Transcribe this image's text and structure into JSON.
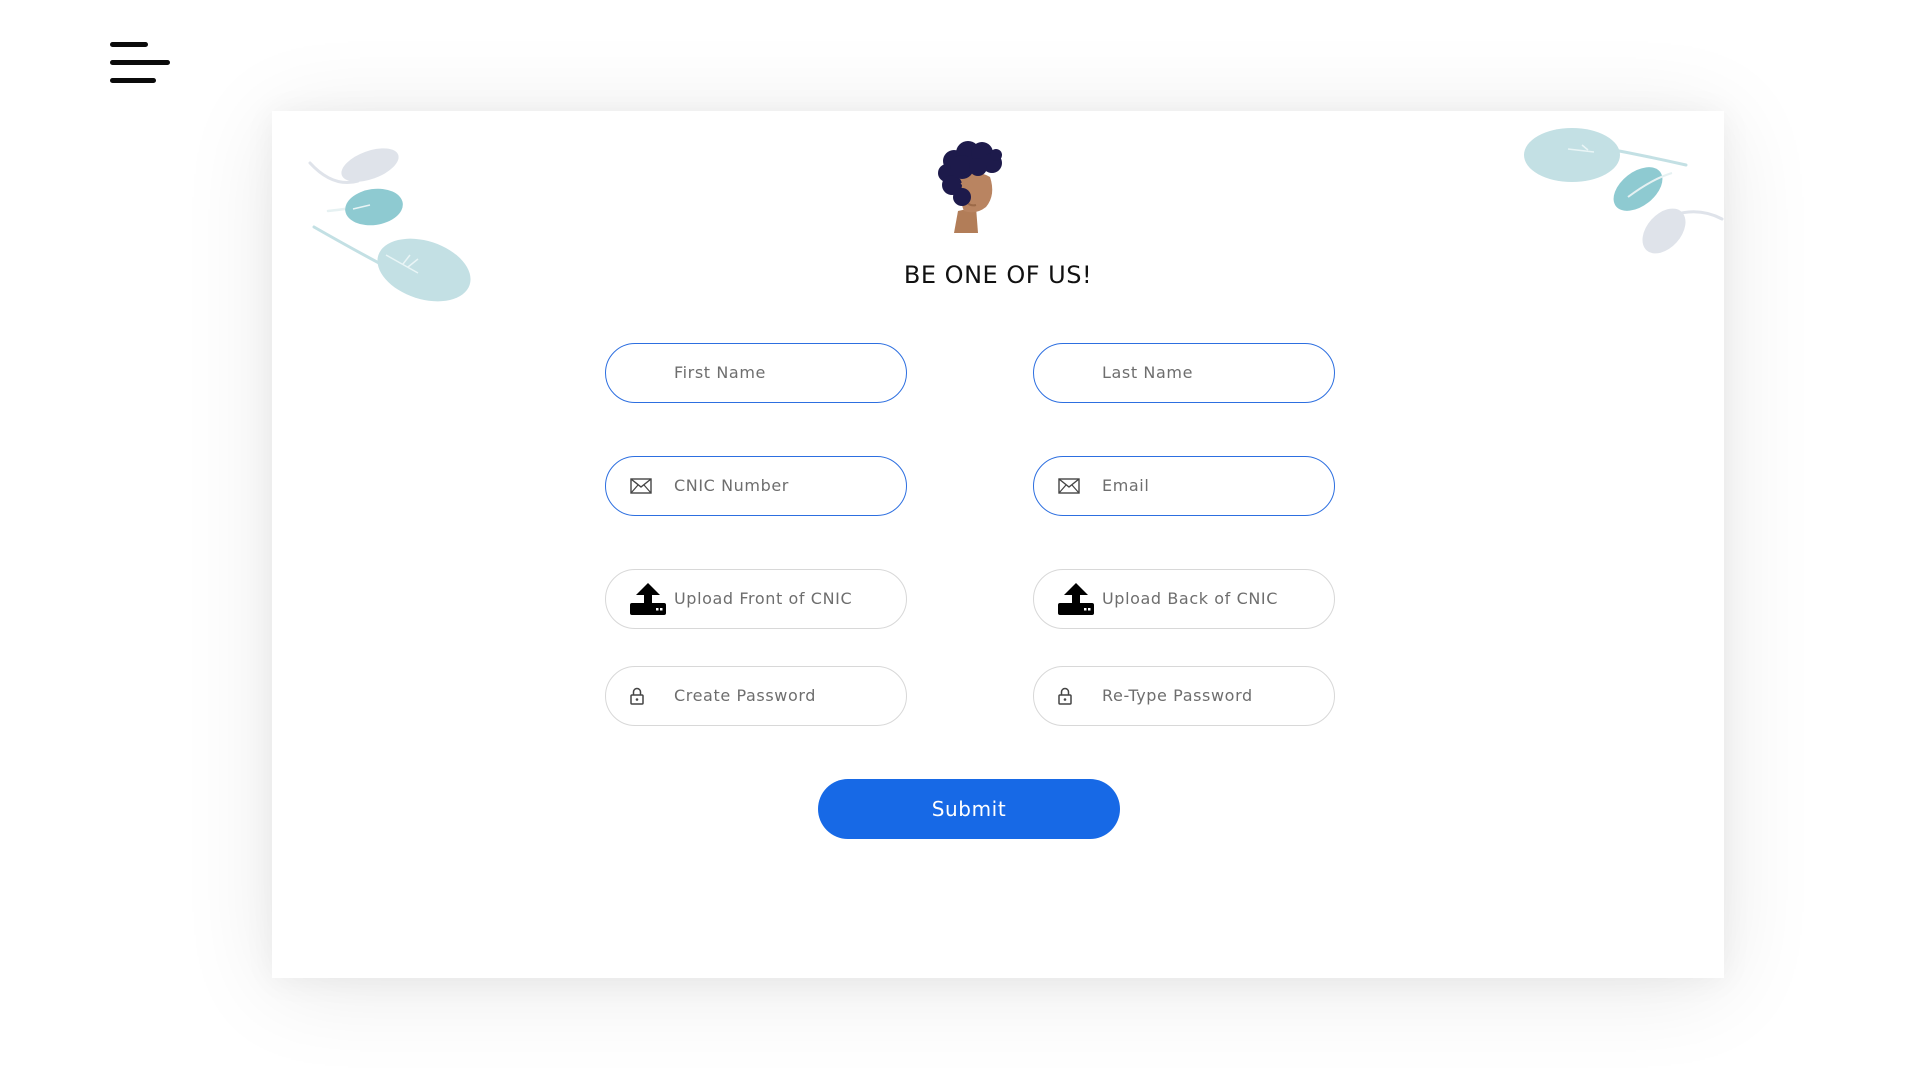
{
  "menu": {
    "icon": "hamburger-menu-icon"
  },
  "form": {
    "title": "BE ONE OF US!",
    "fields": {
      "first_name": {
        "placeholder": "First Name"
      },
      "last_name": {
        "placeholder": "Last Name"
      },
      "cnic": {
        "placeholder": "CNIC Number",
        "icon": "envelope-icon"
      },
      "email": {
        "placeholder": "Email",
        "icon": "envelope-icon"
      },
      "upload_front": {
        "label": "Upload Front of CNIC",
        "icon": "upload-icon"
      },
      "upload_back": {
        "label": "Upload Back of CNIC",
        "icon": "upload-icon"
      },
      "password": {
        "placeholder": "Create Password",
        "icon": "lock-icon"
      },
      "retype_password": {
        "placeholder": "Re-Type Password",
        "icon": "lock-icon"
      }
    },
    "submit_label": "Submit"
  },
  "colors": {
    "accent": "#1769e6",
    "field_border_active": "#2d6fe0",
    "field_border": "#d8d8d8",
    "leaf_teal": "#8ecad1",
    "leaf_light": "#c3e0e4",
    "leaf_gray": "#dfe3ea"
  }
}
